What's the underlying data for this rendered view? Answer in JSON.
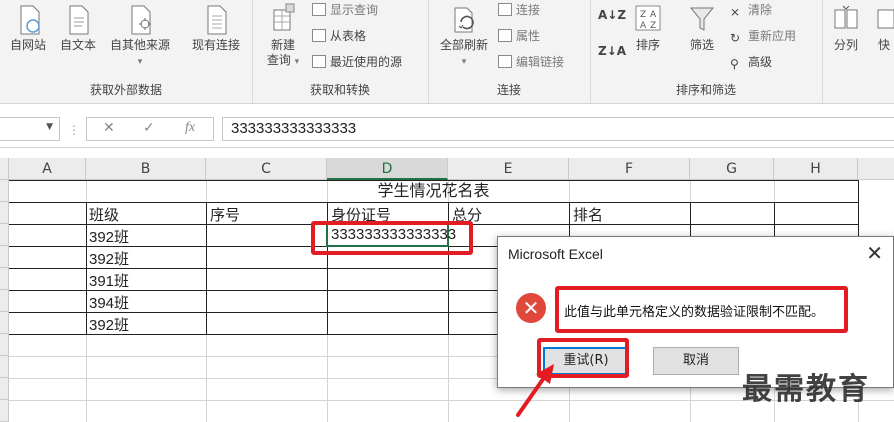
{
  "ribbon": {
    "get_external": {
      "label": "获取外部数据",
      "buttons": [
        "自网站",
        "自文本",
        "自其他来源",
        "现有连接"
      ]
    },
    "get_transform": {
      "label": "获取和转换",
      "new_query": [
        "新建",
        "查询"
      ],
      "items": [
        "显示查询",
        "从表格",
        "最近使用的源"
      ]
    },
    "connections": {
      "label": "连接",
      "refresh_all": "全部刷新",
      "items": [
        "连接",
        "属性",
        "编辑链接"
      ]
    },
    "sort_filter": {
      "label": "排序和筛选",
      "sort": "排序",
      "filter": "筛选",
      "items": [
        "清除",
        "重新应用",
        "高级"
      ]
    },
    "data_tools": {
      "split": "分列",
      "quick": "快"
    }
  },
  "formula_bar": {
    "fx": "fx",
    "value": "333333333333333"
  },
  "columns": [
    "A",
    "B",
    "C",
    "D",
    "E",
    "F",
    "G",
    "H"
  ],
  "sheet": {
    "title": "学生情况花名表",
    "headers": [
      "班级",
      "序号",
      "身份证号",
      "总分",
      "排名"
    ],
    "classes": [
      "392班",
      "392班",
      "391班",
      "394班",
      "392班"
    ],
    "entered_value": "333333333333333"
  },
  "dialog": {
    "title": "Microsoft Excel",
    "close": "✕",
    "message": "此值与此单元格定义的数据验证限制不匹配。",
    "retry": "重试(R)",
    "cancel": "取消"
  },
  "watermark": "最需教育",
  "colors": {
    "excel_green": "#217346",
    "annotation_red": "#e31b23",
    "error_red": "#e0483c",
    "focus_blue": "#0078d7"
  }
}
